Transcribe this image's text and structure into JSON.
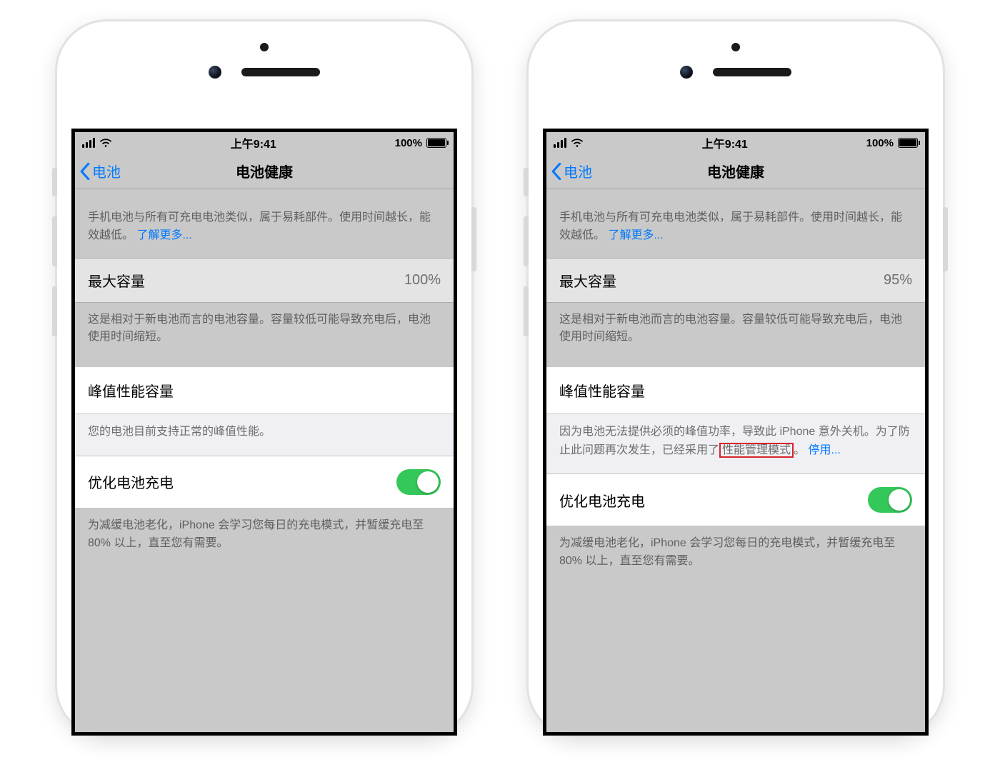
{
  "statusbar": {
    "time": "上午9:41",
    "battery_pct": "100%"
  },
  "navbar": {
    "back_label": "电池",
    "title": "电池健康"
  },
  "intro": {
    "text": "手机电池与所有可充电电池类似，属于易耗部件。使用时间越长，能效越低。",
    "learn_more": "了解更多..."
  },
  "max_capacity": {
    "label": "最大容量",
    "footer": "这是相对于新电池而言的电池容量。容量较低可能导致充电后，电池使用时间缩短。"
  },
  "peak": {
    "label": "峰值性能容量"
  },
  "optimized": {
    "label": "优化电池充电",
    "footer": "为减缓电池老化，iPhone 会学习您每日的充电模式，并暂缓充电至 80% 以上，直至您有需要。"
  },
  "left": {
    "max_capacity_value": "100%",
    "peak_footer": "您的电池目前支持正常的峰值性能。"
  },
  "right": {
    "max_capacity_value": "95%",
    "peak_footer_part1": "因为电池无法提供必须的峰值功率，导致此 iPhone 意外关机。为了防止此问题再次发生，已经采用了",
    "peak_footer_highlight": "性能管理模式",
    "peak_footer_part2": "。",
    "disable_link": "停用..."
  }
}
